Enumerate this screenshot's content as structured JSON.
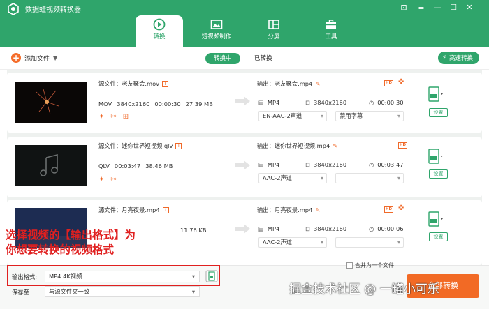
{
  "app": {
    "title": "数据蛙视频转换器"
  },
  "window_controls": [
    {
      "name": "skin-icon",
      "glyph": "⊡"
    },
    {
      "name": "menu-icon",
      "glyph": "≡"
    },
    {
      "name": "minimize-icon",
      "glyph": "—"
    },
    {
      "name": "maximize-icon",
      "glyph": "☐"
    },
    {
      "name": "close-icon",
      "glyph": "✕"
    }
  ],
  "tabs": [
    {
      "label": "转换",
      "icon": "convert-icon",
      "active": true
    },
    {
      "label": "短视频制作",
      "icon": "image-icon",
      "active": false
    },
    {
      "label": "分屏",
      "icon": "split-screen-icon",
      "active": false
    },
    {
      "label": "工具",
      "icon": "toolbox-icon",
      "active": false
    }
  ],
  "toolbar": {
    "add_file": "添加文件",
    "converting": "转换中",
    "converted": "已转换",
    "fast_convert": "高速转换"
  },
  "items": [
    {
      "source": "源文件：老友聚会.mov",
      "format": "MOV",
      "resolution": "3840x2160",
      "duration": "00:00:30",
      "size": "27.39 MB",
      "output": "输出：老友聚会.mp4",
      "out_format": "MP4",
      "out_resolution": "3840x2160",
      "out_duration": "00:00:30",
      "audio": "EN-AAC-2声道",
      "subtitle": "禁用字幕",
      "subtitle_enabled": true,
      "fmt_badge": "MP4",
      "settings": "设置",
      "has_cut": true
    },
    {
      "source": "源文件：迷你世界短视频.qlv",
      "format": "QLV",
      "resolution": "",
      "duration": "00:03:47",
      "size": "38.46 MB",
      "output": "输出：迷你世界短视频.mp4",
      "out_format": "MP4",
      "out_resolution": "3840x2160",
      "out_duration": "00:03:47",
      "audio": "AAC-2声道",
      "subtitle": "",
      "subtitle_enabled": false,
      "fmt_badge": "MP4",
      "settings": "设置",
      "has_cut": false
    },
    {
      "source": "源文件：月亮夜景.mp4",
      "format": "",
      "resolution": "",
      "duration": "",
      "size": "11.76 KB",
      "output": "输出：月亮夜景.mp4",
      "out_format": "MP4",
      "out_resolution": "3840x2160",
      "out_duration": "00:00:06",
      "audio": "AAC-2声道",
      "subtitle": "",
      "subtitle_enabled": false,
      "fmt_badge": "MP4",
      "settings": "设置",
      "has_cut": true
    }
  ],
  "annotation": {
    "line1": "选择视频的【输出格式】为",
    "line2": "你想要转换的视频格式"
  },
  "bottom": {
    "output_format_label": "输出格式:",
    "output_format_value": "MP4 4K视频",
    "save_to_label": "保存至:",
    "save_to_value": "与源文件夹一致",
    "merge_label": "合并为一个文件",
    "convert_button": "全部转换"
  },
  "watermark": "掘金技术社区 @ 一罐小可乐",
  "colors": {
    "brand": "#2fa56b",
    "accent": "#f26a25",
    "annotation": "#e02020"
  }
}
